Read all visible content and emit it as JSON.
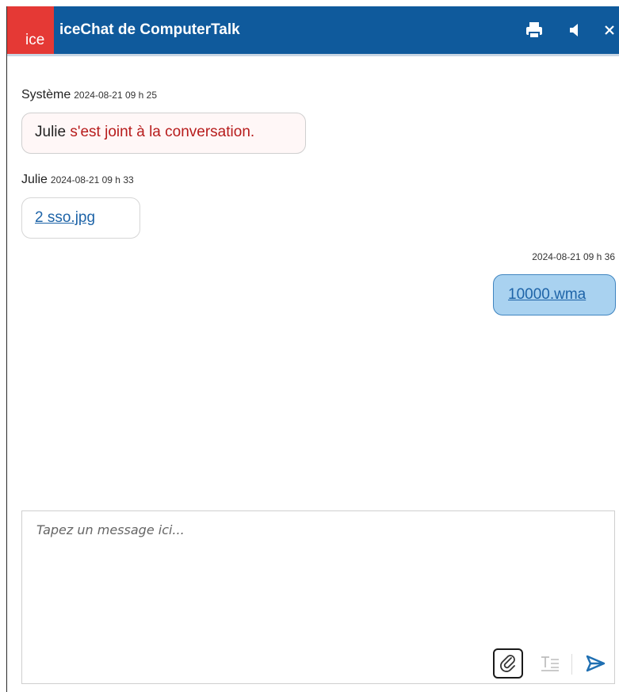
{
  "app": {
    "logo_text": "ice",
    "title": "iceChat de ComputerTalk",
    "colors": {
      "titlebar": "#0f5a9c",
      "logo": "#e53935",
      "my_bubble": "#a9d2f0",
      "link": "#1e64a8",
      "system_text": "#b71c1c"
    }
  },
  "toolbar": {
    "print_icon": "printer-icon",
    "sound_icon": "speaker-icon",
    "close_icon": "close-icon"
  },
  "messages": [
    {
      "sender": "Système",
      "timestamp": "2024-08-21 09 h 25",
      "name": "Julie",
      "text": " s'est joint à la conversation."
    },
    {
      "sender": "Julie",
      "timestamp": "2024-08-21 09 h 33",
      "attachment": "2 sso.jpg"
    },
    {
      "sender": "",
      "timestamp": "2024-08-21 09 h 36",
      "attachment": "10000.wma"
    }
  ],
  "composer": {
    "placeholder": "Tapez un message ici...",
    "value": "",
    "attach_icon": "paperclip-icon",
    "format_icon": "text-format-icon",
    "send_icon": "send-icon"
  }
}
